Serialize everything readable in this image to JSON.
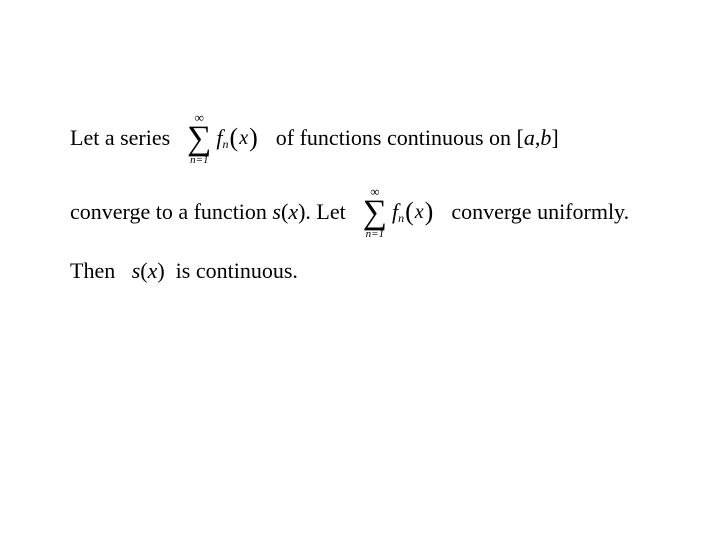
{
  "line1": {
    "t1": "Let a series  ",
    "t2": "  of functions continuous on [",
    "a": "a",
    "comma": ",",
    "b": "b",
    "t3": "]"
  },
  "line2": {
    "t1": "converge to a function ",
    "s": "s ",
    "paren": "(",
    "x": "x",
    "close": "). Let  ",
    "t2": "  converge uniformly."
  },
  "line3": {
    "t1": "Then   ",
    "s": "s ",
    "paren": "(",
    "x": "x",
    "close": ")  is continuous."
  },
  "sum": {
    "top": "∞",
    "sigma": "∑",
    "bottom": "n=1",
    "f": "f",
    "sub": "n",
    "lp": "(",
    "x": "x",
    "rp": ")"
  }
}
